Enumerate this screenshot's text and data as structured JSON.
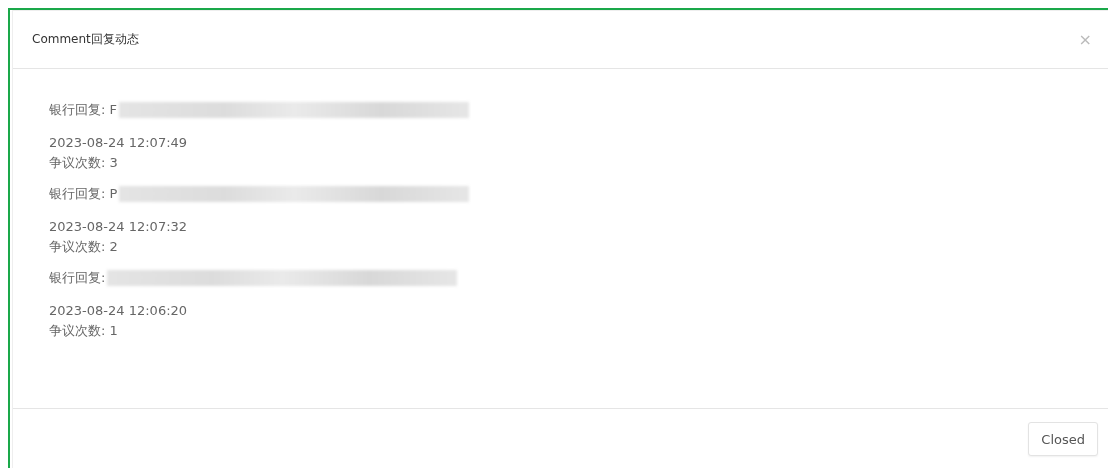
{
  "dialog": {
    "title": "Comment回复动态",
    "close": "×"
  },
  "entries": [
    {
      "reply": "银行回复: F",
      "redacted": true,
      "time": "2023-08-24 12:07:49",
      "count": "争议次数: 3"
    },
    {
      "reply": "银行回复: P",
      "redacted": true,
      "time": "2023-08-24 12:07:32",
      "count": "争议次数: 2"
    },
    {
      "reply": "银行回复:",
      "redacted": true,
      "time": "2023-08-24 12:06:20",
      "count": "争议次数: 1"
    }
  ],
  "buttons": [
    "Closed"
  ]
}
